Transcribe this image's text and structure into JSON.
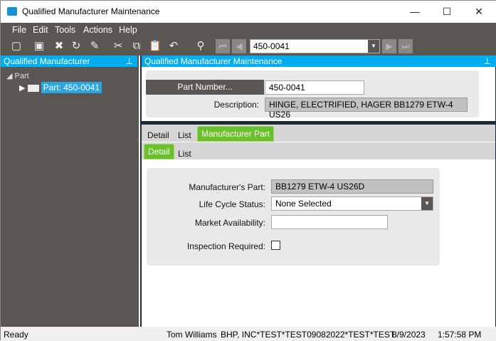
{
  "window": {
    "title": "Qualified Manufacturer Maintenance",
    "minimize": "—",
    "maximize": "☐",
    "close": "✕"
  },
  "menu": [
    "File",
    "Edit",
    "Tools",
    "Actions",
    "Help"
  ],
  "toolbar": {
    "part_value": "450-0041"
  },
  "left_panel": {
    "title": "Qualified Manufacturer",
    "tree_root": "Part",
    "tree_child": "Part: 450-0041"
  },
  "right_panel": {
    "title": "Qualified Manufacturer Maintenance",
    "part_number_button": "Part Number...",
    "part_number_value": "450-0041",
    "description_label": "Description:",
    "description_value": "HINGE, ELECTRIFIED, HAGER BB1279 ETW-4 US26",
    "tabs": [
      "Detail",
      "List",
      "Manufacturer Part"
    ],
    "subtabs": [
      "Detail",
      "List"
    ],
    "form": {
      "mfr_part_label": "Manufacturer's Part:",
      "mfr_part_value": "BB1279 ETW-4 US26D",
      "life_cycle_label": "Life Cycle Status:",
      "life_cycle_value": "None Selected",
      "market_label": "Market Availability:",
      "market_value": "",
      "inspection_label": "Inspection Required:"
    }
  },
  "status": {
    "state": "Ready",
    "user": "Tom Williams",
    "company": "BHP, INC*TEST*TEST09082022*TEST*TEST",
    "date": "8/9/2023",
    "time": "1:57:58 PM"
  }
}
